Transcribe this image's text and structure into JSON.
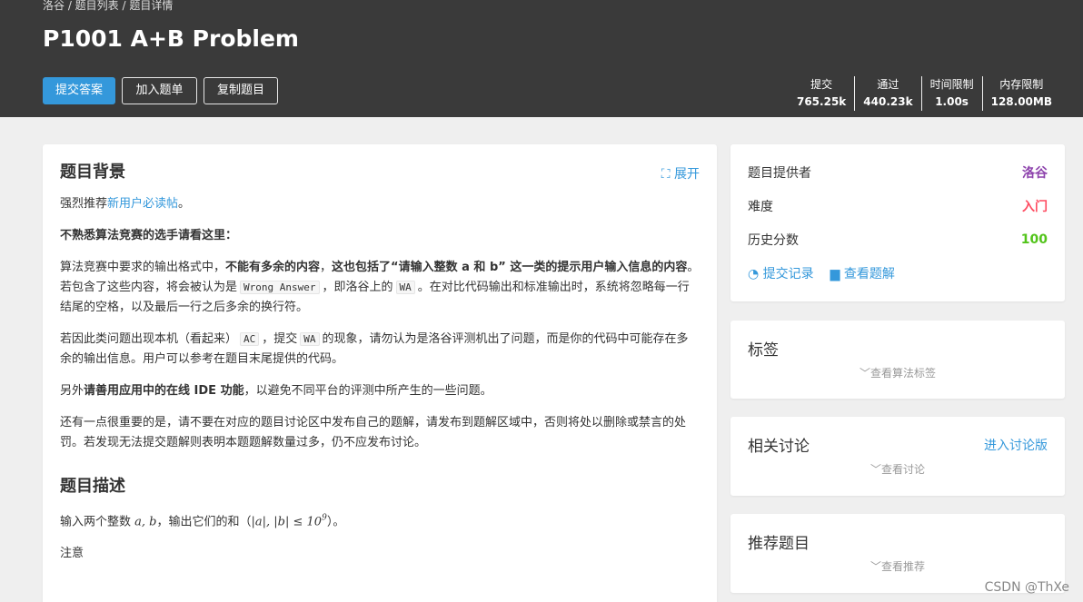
{
  "header": {
    "breadcrumb": "洛谷 / 题目列表 / 题目详情",
    "title": "P1001 A+B Problem",
    "buttons": {
      "submit": "提交答案",
      "add_list": "加入题单",
      "copy": "复制题目"
    },
    "stats": [
      {
        "label": "提交",
        "value": "765.25k"
      },
      {
        "label": "通过",
        "value": "440.23k"
      },
      {
        "label": "时间限制",
        "value": "1.00s"
      },
      {
        "label": "内存限制",
        "value": "128.00MB"
      }
    ]
  },
  "main": {
    "background_title": "题目背景",
    "expand": "展开",
    "p1_prefix": "强烈推荐",
    "p1_link": "新用户必读帖",
    "p1_suffix": "。",
    "p2": "不熟悉算法竞赛的选手请看这里：",
    "p3_a": "算法竞赛中要求的输出格式中，",
    "p3_b": "不能有多余的内容",
    "p3_c": "，",
    "p3_d": "这也包括了“请输入整数 a 和 b” 这一类的提示用户输入信息的内容",
    "p3_e": "。若包含了这些内容，将会被认为是",
    "p3_code1": "Wrong Answer",
    "p3_f": "，即洛谷上的",
    "p3_code2": "WA",
    "p3_g": "。在对比代码输出和标准输出时，系统将忽略每一行结尾的空格，以及最后一行之后多余的换行符。",
    "p4_a": "若因此类问题出现本机（看起来）",
    "p4_code1": "AC",
    "p4_b": "，提交",
    "p4_code2": "WA",
    "p4_c": "的现象，请勿认为是洛谷评测机出了问题，而是你的代码中可能存在多余的输出信息。用户可以参考在题目末尾提供的代码。",
    "p5_a": "另外",
    "p5_b": "请善用应用中的在线 IDE 功能",
    "p5_c": "，以避免不同平台的评测中所产生的一些问题。",
    "p6": "还有一点很重要的是，请不要在对应的题目讨论区中发布自己的题解，请发布到题解区域中，否则将处以删除或禁言的处罚。若发现无法提交题解则表明本题题解数量过多，仍不应发布讨论。",
    "desc_title": "题目描述",
    "desc_prefix": "输入两个整数",
    "desc_math1": "a, b",
    "desc_mid": "，输出它们的和（",
    "desc_math2": "|a|, |b| ≤ 10",
    "desc_exp": "9",
    "desc_suffix": "）。",
    "note": "注意"
  },
  "side": {
    "provider_label": "题目提供者",
    "provider_value": "洛谷",
    "difficulty_label": "难度",
    "difficulty_value": "入门",
    "score_label": "历史分数",
    "score_value": "100",
    "submissions_link": "提交记录",
    "solutions_link": "查看题解",
    "tags_title": "标签",
    "tags_hint": "查看算法标签",
    "discuss_title": "相关讨论",
    "discuss_link": "进入讨论版",
    "discuss_hint": "查看讨论",
    "recommend_title": "推荐题目",
    "recommend_hint": "查看推荐"
  },
  "colors": {
    "accent": "#3498db",
    "provider": "#8e44ad",
    "difficulty": "#fe4c61",
    "score": "#52c41a"
  },
  "watermark": "CSDN @ThXe"
}
